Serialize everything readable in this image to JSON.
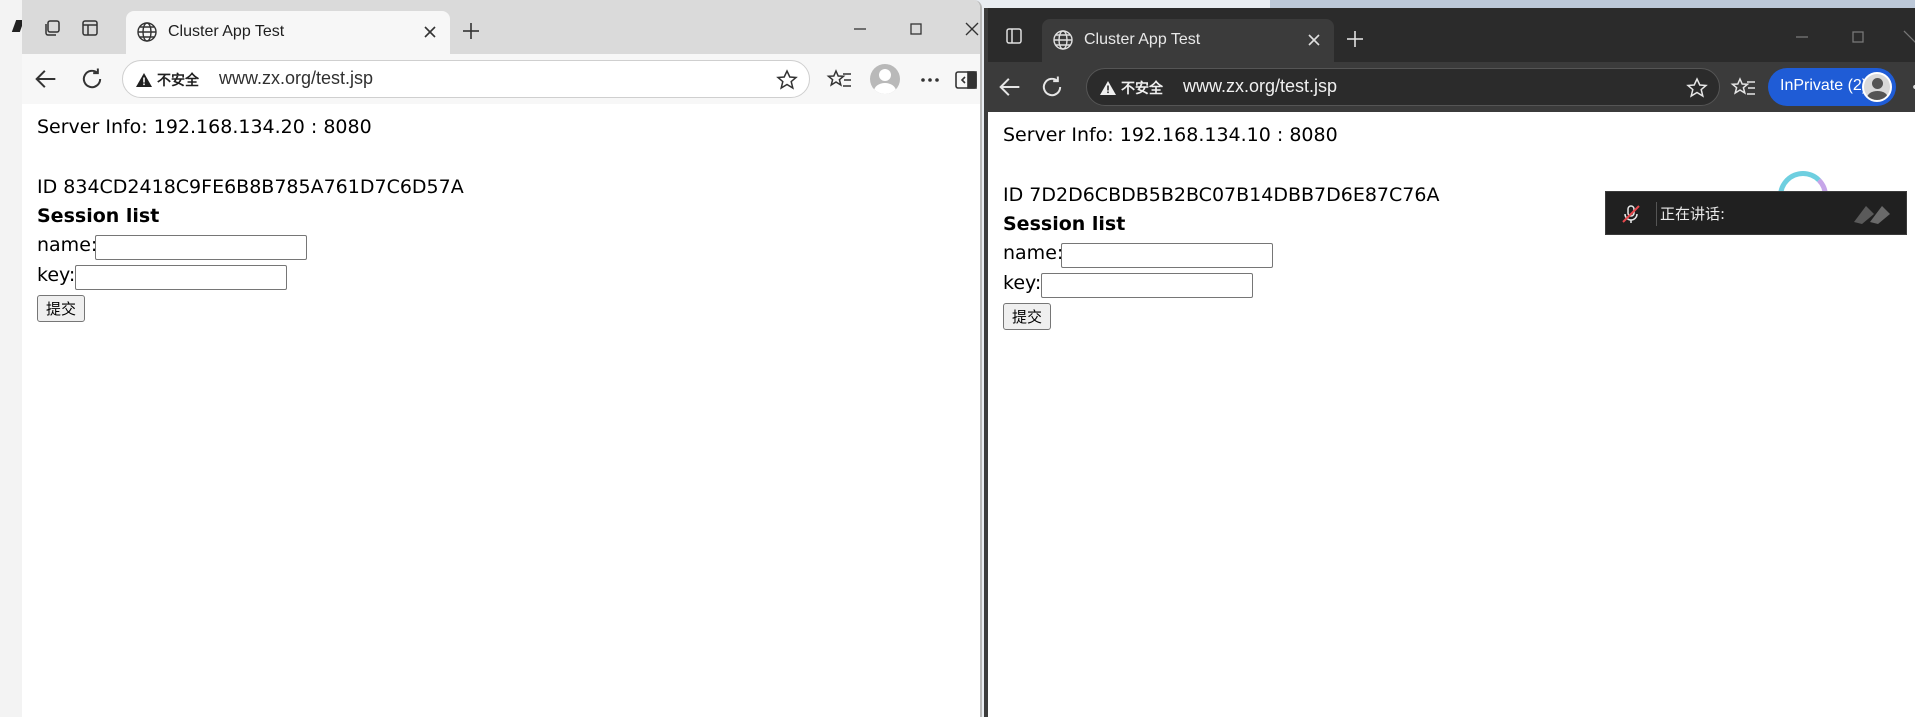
{
  "left_window": {
    "tab_title": "Cluster App Test",
    "security_label": "不安全",
    "url": "www.zx.org/test.jsp",
    "page": {
      "server_info": "Server Info: 192.168.134.20 : 8080",
      "session_id": "ID 834CD2418C9FE6B8B785A761D7C6D57A",
      "session_heading": "Session list",
      "name_label": "name:",
      "key_label": "key:",
      "submit_label": "提交"
    }
  },
  "right_window": {
    "tab_title": "Cluster App Test",
    "security_label": "不安全",
    "url": "www.zx.org/test.jsp",
    "inprivate_label": "InPrivate (2)",
    "page": {
      "server_info": "Server Info: 192.168.134.10 : 8080",
      "session_id": "ID 7D2D6CBDB5B2BC07B14DBB7D6E87C76A",
      "session_heading": "Session list",
      "name_label": "name:",
      "key_label": "key:",
      "submit_label": "提交"
    }
  },
  "notification": {
    "speaking_label": "正在讲话:"
  },
  "colors": {
    "inprivate_blue": "#1f5cd6",
    "dark_chrome": "#2b2b2b",
    "light_chrome": "#dadada"
  }
}
